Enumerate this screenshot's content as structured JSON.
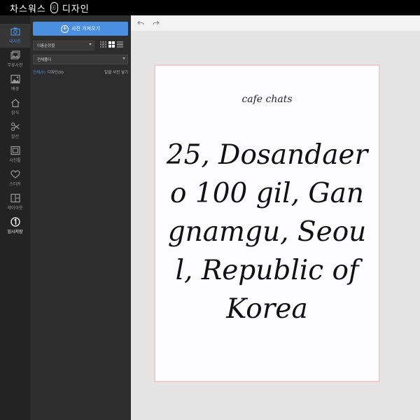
{
  "app": {
    "title_left": "차스워스",
    "logo_glyph": "ⓒ",
    "title_right": "디자인"
  },
  "rail": {
    "items": [
      {
        "label": "내사진",
        "icon": "camera-icon"
      },
      {
        "label": "무료사진",
        "icon": "photos-icon"
      },
      {
        "label": "배경",
        "icon": "image-icon"
      },
      {
        "label": "장식",
        "icon": "house-icon"
      },
      {
        "label": "칼선",
        "icon": "scissors-icon"
      },
      {
        "label": "사진틀",
        "icon": "frame-icon"
      },
      {
        "label": "스티커",
        "icon": "heart-icon"
      },
      {
        "label": "레이아웃",
        "icon": "layout-icon"
      },
      {
        "label": "임시저장",
        "icon": "number-one-icon"
      }
    ]
  },
  "panel": {
    "import_label": "사진 가져오기",
    "sort_value": "이름순정렬",
    "folder_value": "전체폴더",
    "filter_all": "전체(0)",
    "filter_design": "디자인(0)",
    "filter_action": "일괄 사진 넣기"
  },
  "canvas": {
    "title": "cafe chats",
    "address": "25, Dosandaero 100 gil, Gangnamgu, Seoul, Republic of Korea"
  },
  "colors": {
    "accent": "#4a8fe0",
    "paper_border": "#f1cccc"
  }
}
